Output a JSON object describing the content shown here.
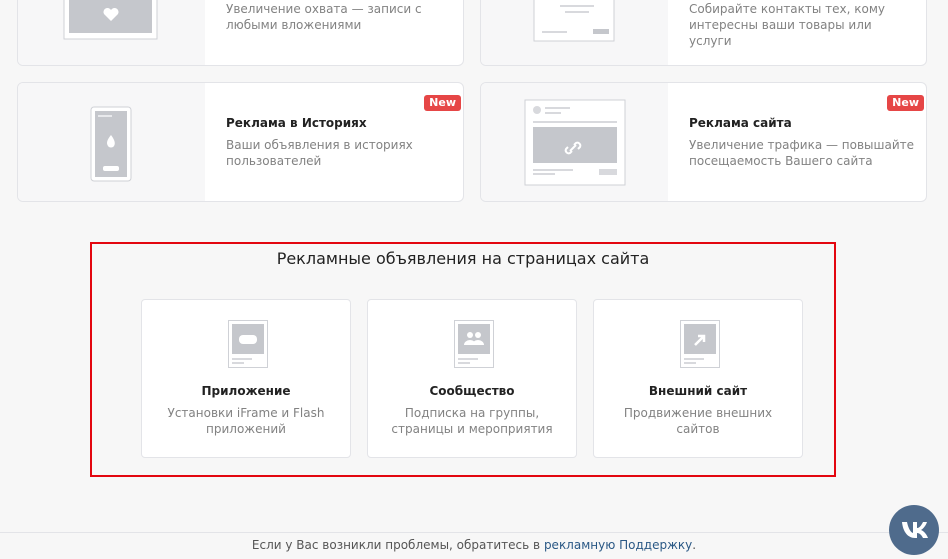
{
  "cards": [
    {
      "title": "",
      "desc": "Увеличение охвата — записи с любыми вложениями"
    },
    {
      "title": "",
      "desc": "Собирайте контакты тех, кому интересны ваши товары или услуги"
    },
    {
      "title": "Реклама в Историях",
      "desc": "Ваши объявления в историях пользователей",
      "badge": "New"
    },
    {
      "title": "Реклама сайта",
      "desc": "Увеличение трафика — повышайте посещаемость Вашего сайта",
      "badge": "New"
    }
  ],
  "section": {
    "title": "Рекламные объявления на страницах сайта",
    "tiles": [
      {
        "title": "Приложение",
        "desc": "Установки iFrame и Flash приложений",
        "icon": "gamepad-icon"
      },
      {
        "title": "Сообщество",
        "desc": "Подписка на группы, страницы и мероприятия",
        "icon": "people-icon"
      },
      {
        "title": "Внешний сайт",
        "desc": "Продвижение внешних сайтов",
        "icon": "external-arrow-icon"
      }
    ]
  },
  "footer": {
    "text": "Если у Вас возникли проблемы, обратитесь в",
    "link1": "рекламную",
    "link2": "Поддержку",
    "end": "."
  },
  "vk_logo": "VK"
}
